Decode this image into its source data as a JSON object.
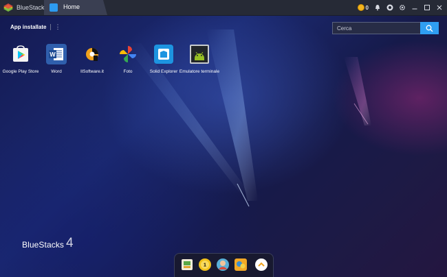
{
  "titlebar": {
    "brand": "BlueStacks",
    "tab_label": "Home",
    "coins": "0",
    "icons": [
      "coin-icon",
      "bell-icon",
      "account-icon",
      "gear-icon",
      "minimize-icon",
      "maximize-icon",
      "close-icon"
    ]
  },
  "main": {
    "section_title": "App installate",
    "menu_glyph": "⋮",
    "search_placeholder": "Cerca",
    "apps": [
      {
        "label": "Google Play Store",
        "icon": "google-play-store-icon"
      },
      {
        "label": "Word",
        "icon": "word-icon"
      },
      {
        "label": "IlSoftware.it",
        "icon": "ilsoftware-icon"
      },
      {
        "label": "Foto",
        "icon": "google-photos-icon"
      },
      {
        "label": "Solid Explorer",
        "icon": "solid-explorer-icon"
      },
      {
        "label": "Emulatore terminale",
        "icon": "terminal-emulator-icon"
      }
    ]
  },
  "footer": {
    "logo_text": "BlueStacks",
    "logo_version": "4",
    "dock_icons": [
      "app-center-icon",
      "top-charts-icon",
      "game-avatar-icon",
      "game-promo-icon",
      "expand-up-icon"
    ]
  },
  "colors": {
    "accent": "#2f9ef2",
    "titlebar": "#262a36",
    "coin": "#f2b41f"
  }
}
